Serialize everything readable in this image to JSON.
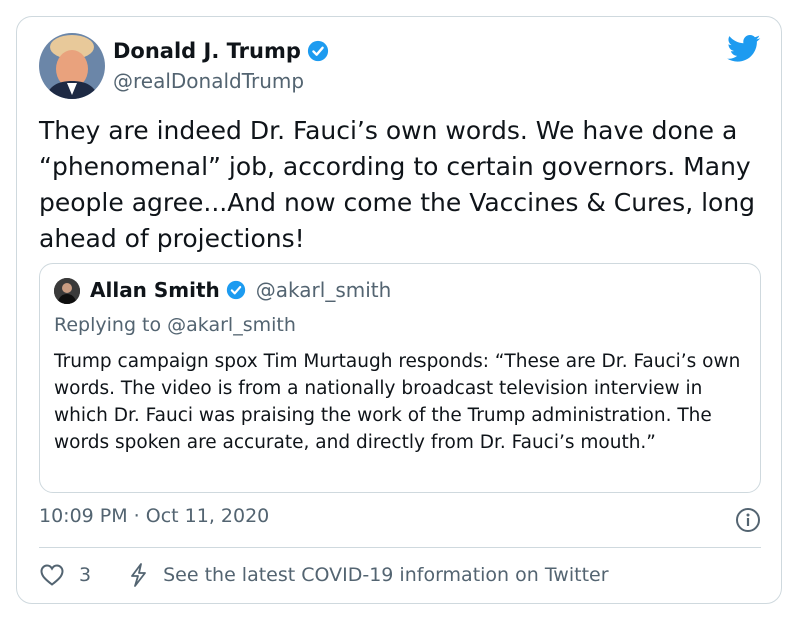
{
  "author": {
    "name": "Donald J. Trump",
    "handle": "@realDonaldTrump"
  },
  "tweet": {
    "text": "They are indeed Dr. Fauci’s own words. We have done a “phenomenal” job, according to certain governors. Many people agree...And now come the Vaccines & Cures, long ahead of projections!"
  },
  "quoted": {
    "name": "Allan Smith",
    "handle": "@akarl_smith",
    "replying_to": "Replying to @akarl_smith",
    "text": "Trump campaign spox Tim Murtaugh responds: “These are Dr. Fauci’s own words. The video is from a nationally broadcast television interview in which Dr. Fauci was praising the work of the Trump administration. The words spoken are accurate, and directly from Dr. Fauci’s mouth.”"
  },
  "meta": {
    "timestamp": "10:09 PM · Oct 11, 2020"
  },
  "actions": {
    "like_count": "3",
    "covid_link": "See the latest COVID-19 information on Twitter"
  },
  "colors": {
    "twitter_blue": "#1d9bf0",
    "secondary_text": "#536471",
    "border": "#cfd9de"
  },
  "icons": [
    "verified-badge-icon",
    "twitter-bird-icon",
    "info-icon",
    "heart-icon",
    "lightning-bolt-icon"
  ]
}
